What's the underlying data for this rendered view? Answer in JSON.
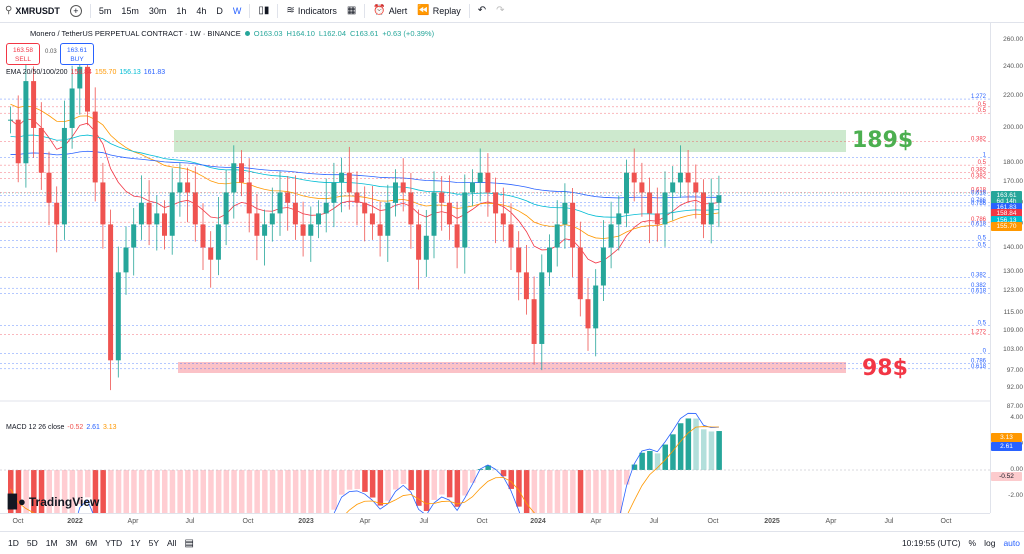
{
  "toolbar": {
    "symbol": "XMRUSDT",
    "add_symbol": "+",
    "intervals": [
      "5m",
      "15m",
      "30m",
      "1h",
      "4h",
      "D",
      "W"
    ],
    "active_interval": "W",
    "indicators_label": "Indicators",
    "alert_label": "Alert",
    "replay_label": "Replay"
  },
  "legend": {
    "title": "Monero / TetherUS PERPETUAL CONTRACT · 1W · BINANCE",
    "open": "O163.03",
    "high": "H164.10",
    "low": "L162.04",
    "close": "C163.61",
    "change": "+0.63 (+0.39%)"
  },
  "trade": {
    "sell_price": "163.58",
    "sell_label": "SELL",
    "spread": "0.03",
    "buy_price": "163.61",
    "buy_label": "BUY"
  },
  "ema": {
    "label": "EMA 20/50/100/200",
    "v20": "158.84",
    "v50": "155.70",
    "v100": "156.13",
    "v200": "161.83"
  },
  "macd": {
    "label": "MACD 12 26 close",
    "hist": "-0.52",
    "macd": "2.61",
    "signal": "3.13"
  },
  "annotations": {
    "resistance": "189$",
    "support": "98$"
  },
  "price_axis": [
    "260.00",
    "240.00",
    "220.00",
    "200.00",
    "180.00",
    "170.00",
    "160.00",
    "150.00",
    "140.00",
    "130.00",
    "123.00",
    "115.00",
    "109.00",
    "103.00",
    "97.00",
    "92.00",
    "87.00"
  ],
  "price_tags": {
    "close": "163.61",
    "countdown": "6d 14h",
    "ema200": "161.83",
    "ema20": "158.84",
    "ema100": "156.13",
    "ema50": "155.70",
    "macd_signal": "3.13",
    "macd_line": "2.61",
    "macd_hist": "-0.52"
  },
  "macd_axis": [
    "4.00",
    "2.00",
    "0.00",
    "-2.00"
  ],
  "fib_labels": [
    "1.272",
    "0.5",
    "0.5",
    "0.382",
    "1",
    "0.5",
    "0.382",
    "0.382",
    "0.618",
    "0.786",
    "0.786",
    "0.618",
    "0.786",
    "0.618",
    "0.5",
    "0.5",
    "0.382",
    "0.382",
    "0.618",
    "0.5",
    "1.272",
    "0",
    "0.786",
    "0.618"
  ],
  "time_axis": [
    "Oct",
    "2022",
    "Apr",
    "Jul",
    "Oct",
    "2023",
    "Apr",
    "Jul",
    "Oct",
    "2024",
    "Apr",
    "Jul",
    "Oct",
    "2025",
    "Apr",
    "Jul",
    "Oct"
  ],
  "bottom": {
    "ranges": [
      "1D",
      "5D",
      "1M",
      "3M",
      "6M",
      "YTD",
      "1Y",
      "5Y",
      "All"
    ],
    "time": "10:19:55 (UTC)",
    "log": "%",
    "log2": "log",
    "auto": "auto"
  },
  "logo": "TradingView",
  "colors": {
    "up": "#26a69a",
    "down": "#ef5350",
    "ema20": "#f23645",
    "ema50": "#ff9800",
    "ema100": "#00bcd4",
    "ema200": "#2962ff",
    "resist_zone": "#4caf50",
    "support_zone": "#f23645"
  },
  "chart_data": {
    "type": "candlestick",
    "candles_weekly_close_approx": [
      205,
      180,
      230,
      200,
      175,
      160,
      150,
      200,
      225,
      240,
      210,
      170,
      150,
      100,
      130,
      140,
      150,
      160,
      150,
      155,
      145,
      165,
      170,
      165,
      150,
      140,
      135,
      150,
      165,
      180,
      170,
      155,
      145,
      150,
      155,
      165,
      160,
      150,
      145,
      150,
      155,
      160,
      170,
      175,
      165,
      160,
      155,
      150,
      145,
      160,
      170,
      165,
      150,
      135,
      145,
      165,
      160,
      150,
      140,
      165,
      170,
      175,
      165,
      155,
      150,
      140,
      130,
      120,
      105,
      130,
      140,
      150,
      160,
      140,
      120,
      110,
      125,
      140,
      150,
      155,
      175,
      170,
      165,
      155,
      150,
      165,
      170,
      175,
      170,
      165,
      150,
      160,
      163.61
    ]
  }
}
